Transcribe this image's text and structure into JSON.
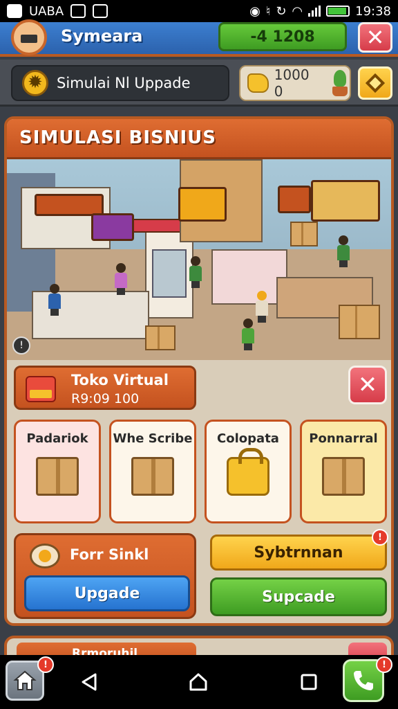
{
  "status_bar": {
    "carrier": "UABA",
    "time": "19:38"
  },
  "header": {
    "player_name": "Symeara",
    "money": "-4 1208"
  },
  "info_bar": {
    "sim_label": "Simulai Nl Uppade",
    "coins": "1000 0"
  },
  "panel": {
    "title": "SIMULASI BISNIUS",
    "scene_badge": "!",
    "shop": {
      "name": "Toko Virtual",
      "price": "R9:09 100"
    },
    "categories": [
      {
        "label": "Padariok",
        "color": "#fde3e1"
      },
      {
        "label": "Whe Scribe",
        "color": "#fdf6ea"
      },
      {
        "label": "Colopata",
        "color": "#fdf6ea"
      },
      {
        "label": "Ponnarral",
        "color": "#fbe9a8"
      }
    ],
    "action": {
      "title": "Forr Sinkl",
      "upgrade_label": "Upgade",
      "yellow_label": "Sybtrnnan",
      "yellow_badge": "!",
      "green_label": "Supcade"
    }
  },
  "next_panel": {
    "label": "Rrmoruhil"
  },
  "nav": {
    "home_badge": "!",
    "phone_badge": "!"
  },
  "colors": {
    "accent_orange": "#c4521f",
    "header_blue": "#2c62ad",
    "money_green": "#3e9c22",
    "close_red": "#d63c49"
  }
}
